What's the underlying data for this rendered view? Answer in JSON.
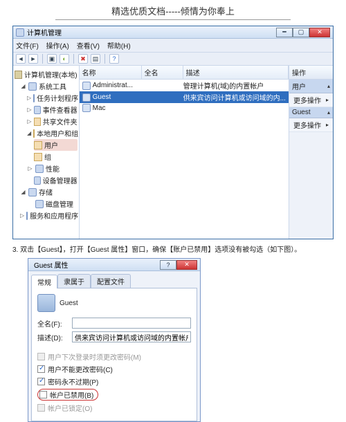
{
  "doc": {
    "header": "精选优质文档-----倾情为你奉上"
  },
  "mainWindow": {
    "title": "计算机管理",
    "menu": {
      "file": "文件(F)",
      "action": "操作(A)",
      "view": "查看(V)",
      "help": "帮助(H)"
    },
    "tree": {
      "root": "计算机管理(本地)",
      "sysTools": "系统工具",
      "taskSched": "任务计划程序",
      "eventViewer": "事件查看器",
      "sharedFolders": "共享文件夹",
      "localUsersGroups": "本地用户和组",
      "users": "用户",
      "groups": "组",
      "perf": "性能",
      "devMgr": "设备管理器",
      "storage": "存储",
      "diskMgmt": "磁盘管理",
      "services": "服务和应用程序"
    },
    "columns": {
      "name": "名称",
      "fullname": "全名",
      "desc": "描述"
    },
    "rows": [
      {
        "name": "Administrat...",
        "fullname": "",
        "desc": "管理计算机(域)的内置帐户"
      },
      {
        "name": "Guest",
        "fullname": "",
        "desc": "供来宾访问计算机或访问域的内..."
      },
      {
        "name": "Mac",
        "fullname": "",
        "desc": ""
      }
    ],
    "actions": {
      "header": "操作",
      "group1": "用户",
      "more1": "更多操作",
      "group2": "Guest",
      "more2": "更多操作"
    }
  },
  "step": "3. 双击【Guest】，打开【Guest 属性】窗口，确保【账户已禁用】选项没有被勾选（如下图）。",
  "dialog": {
    "title": "Guest 属性",
    "tabs": {
      "general": "常规",
      "memberOf": "隶属于",
      "profile": "配置文件"
    },
    "iconLabel": "Guest",
    "fullnameLabel": "全名(F):",
    "fullnameValue": "",
    "descLabel": "描述(D):",
    "descValue": "供来宾访问计算机或访问域的内置帐户",
    "cb1": "用户下次登录时须更改密码(M)",
    "cb2": "用户不能更改密码(C)",
    "cb3": "密码永不过期(P)",
    "cb4": "帐户已禁用(B)",
    "cb5": "帐户已锁定(O)"
  }
}
